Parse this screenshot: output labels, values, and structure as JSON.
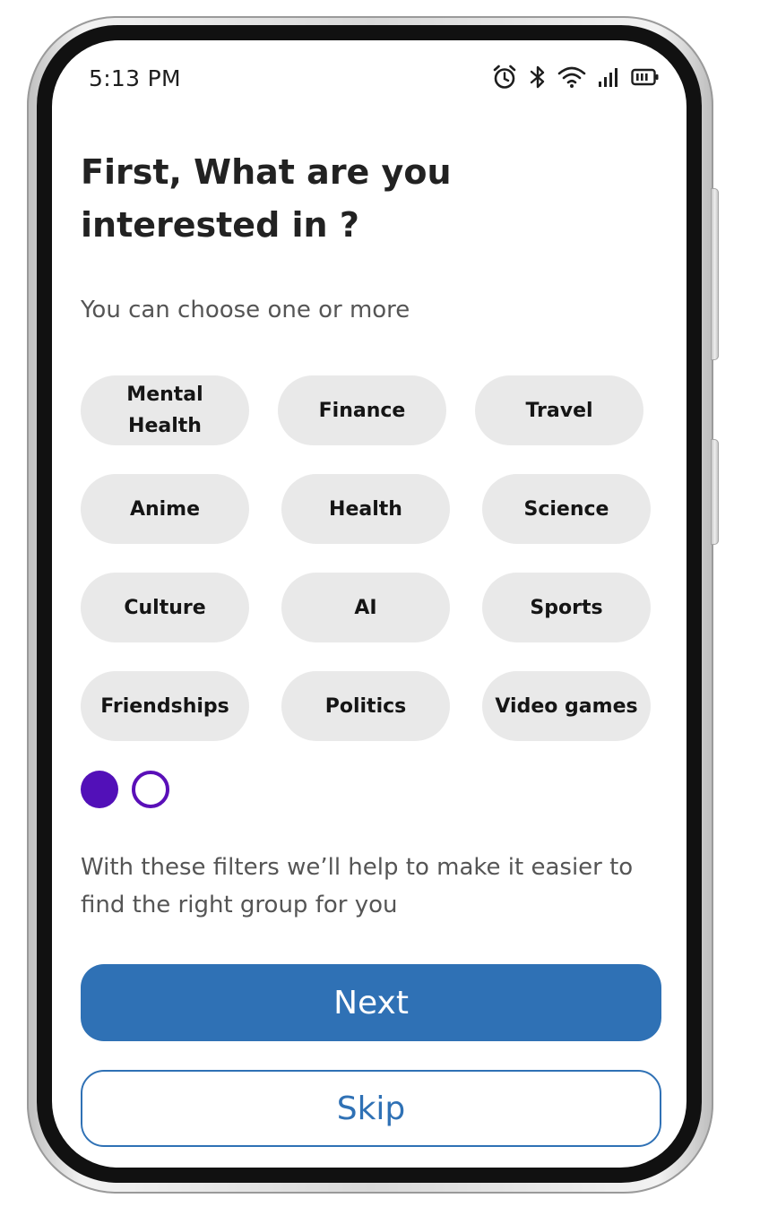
{
  "status_bar": {
    "time": "5:13 PM",
    "icons": [
      "alarm-icon",
      "bluetooth-icon",
      "wifi-icon",
      "signal-icon",
      "battery-icon"
    ]
  },
  "onboarding": {
    "title": "First, What are you interested in ?",
    "subtitle": "You can choose one or more",
    "interests": [
      "Mental Health",
      "Finance",
      "Travel",
      "Anime",
      "Health",
      "Science",
      "Culture",
      "AI",
      "Sports",
      "Friendships",
      "Politics",
      "Video games"
    ],
    "pager": {
      "current": 1,
      "total": 2
    },
    "helper_text": "With these filters we’ll help to make it easier to find the right group for you",
    "next_label": "Next",
    "skip_label": "Skip"
  },
  "colors": {
    "primary": "#2f71b5",
    "pager_active": "#5210b8",
    "chip_bg": "#e9e9e9",
    "heading": "#222222",
    "body_text": "#555555"
  }
}
